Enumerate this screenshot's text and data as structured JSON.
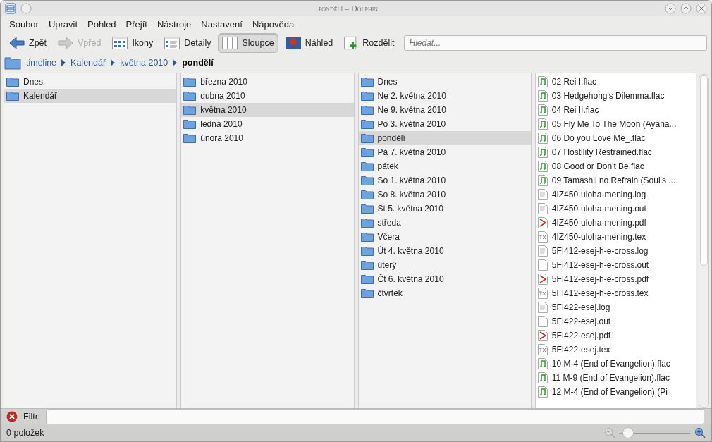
{
  "window": {
    "title": "pondělí – Dolphin"
  },
  "menu": [
    "Soubor",
    "Upravit",
    "Pohled",
    "Přejít",
    "Nástroje",
    "Nastavení",
    "Nápověda"
  ],
  "toolbar": [
    {
      "kind": "back",
      "label": "Zpět",
      "disabled": false,
      "selected": false
    },
    {
      "kind": "forward",
      "label": "Vpřed",
      "disabled": true,
      "selected": false
    },
    {
      "kind": "icons",
      "label": "Ikony",
      "disabled": false,
      "selected": false
    },
    {
      "kind": "details",
      "label": "Detaily",
      "disabled": false,
      "selected": false
    },
    {
      "kind": "columns",
      "label": "Sloupce",
      "disabled": false,
      "selected": true
    },
    {
      "kind": "preview",
      "label": "Náhled",
      "disabled": false,
      "selected": false
    },
    {
      "kind": "split",
      "label": "Rozdělit",
      "disabled": false,
      "selected": false
    }
  ],
  "search": {
    "placeholder": "Hledat..."
  },
  "breadcrumb": [
    {
      "label": "timeline",
      "selected": false
    },
    {
      "label": "Kalendář",
      "selected": false
    },
    {
      "label": "května 2010",
      "selected": false
    },
    {
      "label": "pondělí",
      "selected": true
    }
  ],
  "columns": [
    {
      "items": [
        {
          "name": "Dnes",
          "kind": "folder",
          "selected": false
        },
        {
          "name": "Kalendář",
          "kind": "folder",
          "selected": true
        }
      ]
    },
    {
      "items": [
        {
          "name": "března 2010",
          "kind": "folder",
          "selected": false
        },
        {
          "name": "dubna 2010",
          "kind": "folder",
          "selected": false
        },
        {
          "name": "května 2010",
          "kind": "folder",
          "selected": true
        },
        {
          "name": "ledna 2010",
          "kind": "folder",
          "selected": false
        },
        {
          "name": "února 2010",
          "kind": "folder",
          "selected": false
        }
      ]
    },
    {
      "items": [
        {
          "name": "Dnes",
          "kind": "folder",
          "selected": false
        },
        {
          "name": "Ne 2. května 2010",
          "kind": "folder",
          "selected": false
        },
        {
          "name": "Ne 9. května 2010",
          "kind": "folder",
          "selected": false
        },
        {
          "name": "Po 3. května 2010",
          "kind": "folder",
          "selected": false
        },
        {
          "name": "pondělí",
          "kind": "folder",
          "selected": true
        },
        {
          "name": "Pá 7. května 2010",
          "kind": "folder",
          "selected": false
        },
        {
          "name": "pátek",
          "kind": "folder",
          "selected": false
        },
        {
          "name": "So 1. května 2010",
          "kind": "folder",
          "selected": false
        },
        {
          "name": "So 8. května 2010",
          "kind": "folder",
          "selected": false
        },
        {
          "name": "St 5. května 2010",
          "kind": "folder",
          "selected": false
        },
        {
          "name": "středa",
          "kind": "folder",
          "selected": false
        },
        {
          "name": "Včera",
          "kind": "folder",
          "selected": false
        },
        {
          "name": "Út 4. května 2010",
          "kind": "folder",
          "selected": false
        },
        {
          "name": "úterý",
          "kind": "folder",
          "selected": false
        },
        {
          "name": "Čt 6. května 2010",
          "kind": "folder",
          "selected": false
        },
        {
          "name": "čtvrtek",
          "kind": "folder",
          "selected": false
        }
      ]
    },
    {
      "items": [
        {
          "name": "02 Rei I.flac",
          "kind": "audio",
          "selected": false
        },
        {
          "name": "03 Hedgehong's Dilemma.flac",
          "kind": "audio",
          "selected": false
        },
        {
          "name": "04 Rei II.flac",
          "kind": "audio",
          "selected": false
        },
        {
          "name": "05 Fly Me To The Moon (Ayana...",
          "kind": "audio",
          "selected": false
        },
        {
          "name": "06 Do you Love Me_.flac",
          "kind": "audio",
          "selected": false
        },
        {
          "name": "07 Hostility Restrained.flac",
          "kind": "audio",
          "selected": false
        },
        {
          "name": "08 Good or Don't Be.flac",
          "kind": "audio",
          "selected": false
        },
        {
          "name": "09 Tamashii no Refrain (Soul's ...",
          "kind": "audio",
          "selected": false
        },
        {
          "name": "4IZ450-uloha-mening.log",
          "kind": "text",
          "selected": false
        },
        {
          "name": "4IZ450-uloha-mening.out",
          "kind": "text",
          "selected": false
        },
        {
          "name": "4IZ450-uloha-mening.pdf",
          "kind": "pdf",
          "selected": false
        },
        {
          "name": "4IZ450-uloha-mening.tex",
          "kind": "tex",
          "selected": false
        },
        {
          "name": "5FI412-esej-h-e-cross.log",
          "kind": "text",
          "selected": false
        },
        {
          "name": "5FI412-esej-h-e-cross.out",
          "kind": "blank",
          "selected": false
        },
        {
          "name": "5FI412-esej-h-e-cross.pdf",
          "kind": "pdf",
          "selected": false
        },
        {
          "name": "5FI412-esej-h-e-cross.tex",
          "kind": "tex",
          "selected": false
        },
        {
          "name": "5FI422-esej.log",
          "kind": "text",
          "selected": false
        },
        {
          "name": "5FI422-esej.out",
          "kind": "blank",
          "selected": false
        },
        {
          "name": "5FI422-esej.pdf",
          "kind": "pdf",
          "selected": false
        },
        {
          "name": "5FI422-esej.tex",
          "kind": "tex",
          "selected": false
        },
        {
          "name": "10 M-4 (End of Evangelion).flac",
          "kind": "audio",
          "selected": false
        },
        {
          "name": "11 M-9 (End of Evangelion).flac",
          "kind": "audio",
          "selected": false
        },
        {
          "name": "12 M-4 (End of Evangelion) (Pi",
          "kind": "audio",
          "selected": false
        }
      ]
    }
  ],
  "filter": {
    "label": "Filtr:"
  },
  "status_bar": {
    "text": "0 položek",
    "zoom": {
      "level": 0.05
    }
  }
}
